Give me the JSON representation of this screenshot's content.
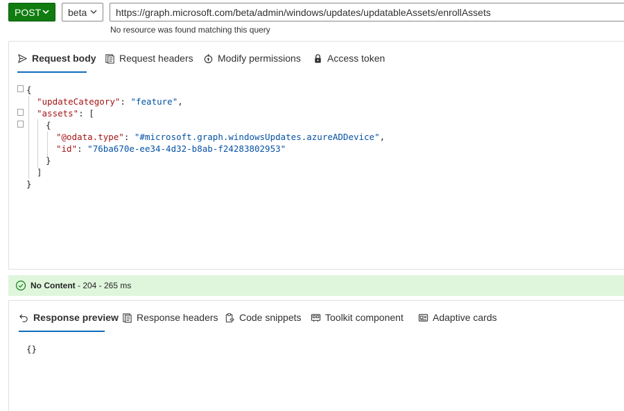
{
  "query_bar": {
    "method": "POST",
    "version": "beta",
    "url": "https://graph.microsoft.com/beta/admin/windows/updates/updatableAssets/enrollAssets",
    "error": "No resource was found matching this query"
  },
  "request_tabs": [
    {
      "label": "Request body",
      "icon": "send-icon",
      "active": true
    },
    {
      "label": "Request headers",
      "icon": "document-header-icon",
      "active": false
    },
    {
      "label": "Modify permissions",
      "icon": "key-lock-icon",
      "active": false
    },
    {
      "label": "Access token",
      "icon": "lock-icon",
      "active": false
    }
  ],
  "request_body": {
    "line1": "{",
    "line2_key": "\"updateCategory\"",
    "line2_colon": ": ",
    "line2_value": "\"feature\"",
    "line2_comma": ",",
    "line3_key": "\"assets\"",
    "line3_rest": ": [",
    "line4": "{",
    "line5_key": "\"@odata.type\"",
    "line5_colon": ": ",
    "line5_value": "\"#microsoft.graph.windowsUpdates.azureADDevice\"",
    "line5_comma": ",",
    "line6_key": "\"id\"",
    "line6_colon": ": ",
    "line6_value": "\"76ba670e-ee34-4d32-b8ab-f24283802953\"",
    "line7": "}",
    "line8": "]",
    "line9": "}"
  },
  "status": {
    "label": "No Content",
    "detail": " - 204 - 265 ms",
    "color": "#dff6dd",
    "icon": "check-circle-icon"
  },
  "response_tabs": [
    {
      "label": "Response preview",
      "icon": "undo-arrow-icon",
      "active": true
    },
    {
      "label": "Response headers",
      "icon": "document-header-icon",
      "active": false
    },
    {
      "label": "Code snippets",
      "icon": "clipboard-code-icon",
      "active": false
    },
    {
      "label": "Toolkit component",
      "icon": "toolkit-icon",
      "active": false
    },
    {
      "label": "Adaptive cards",
      "icon": "card-icon",
      "active": false
    }
  ],
  "response_body": "{}",
  "colors": {
    "accent": "#0f6cbd",
    "method_green": "#107c10",
    "json_key": "#a31515",
    "json_string": "#0451a5"
  }
}
